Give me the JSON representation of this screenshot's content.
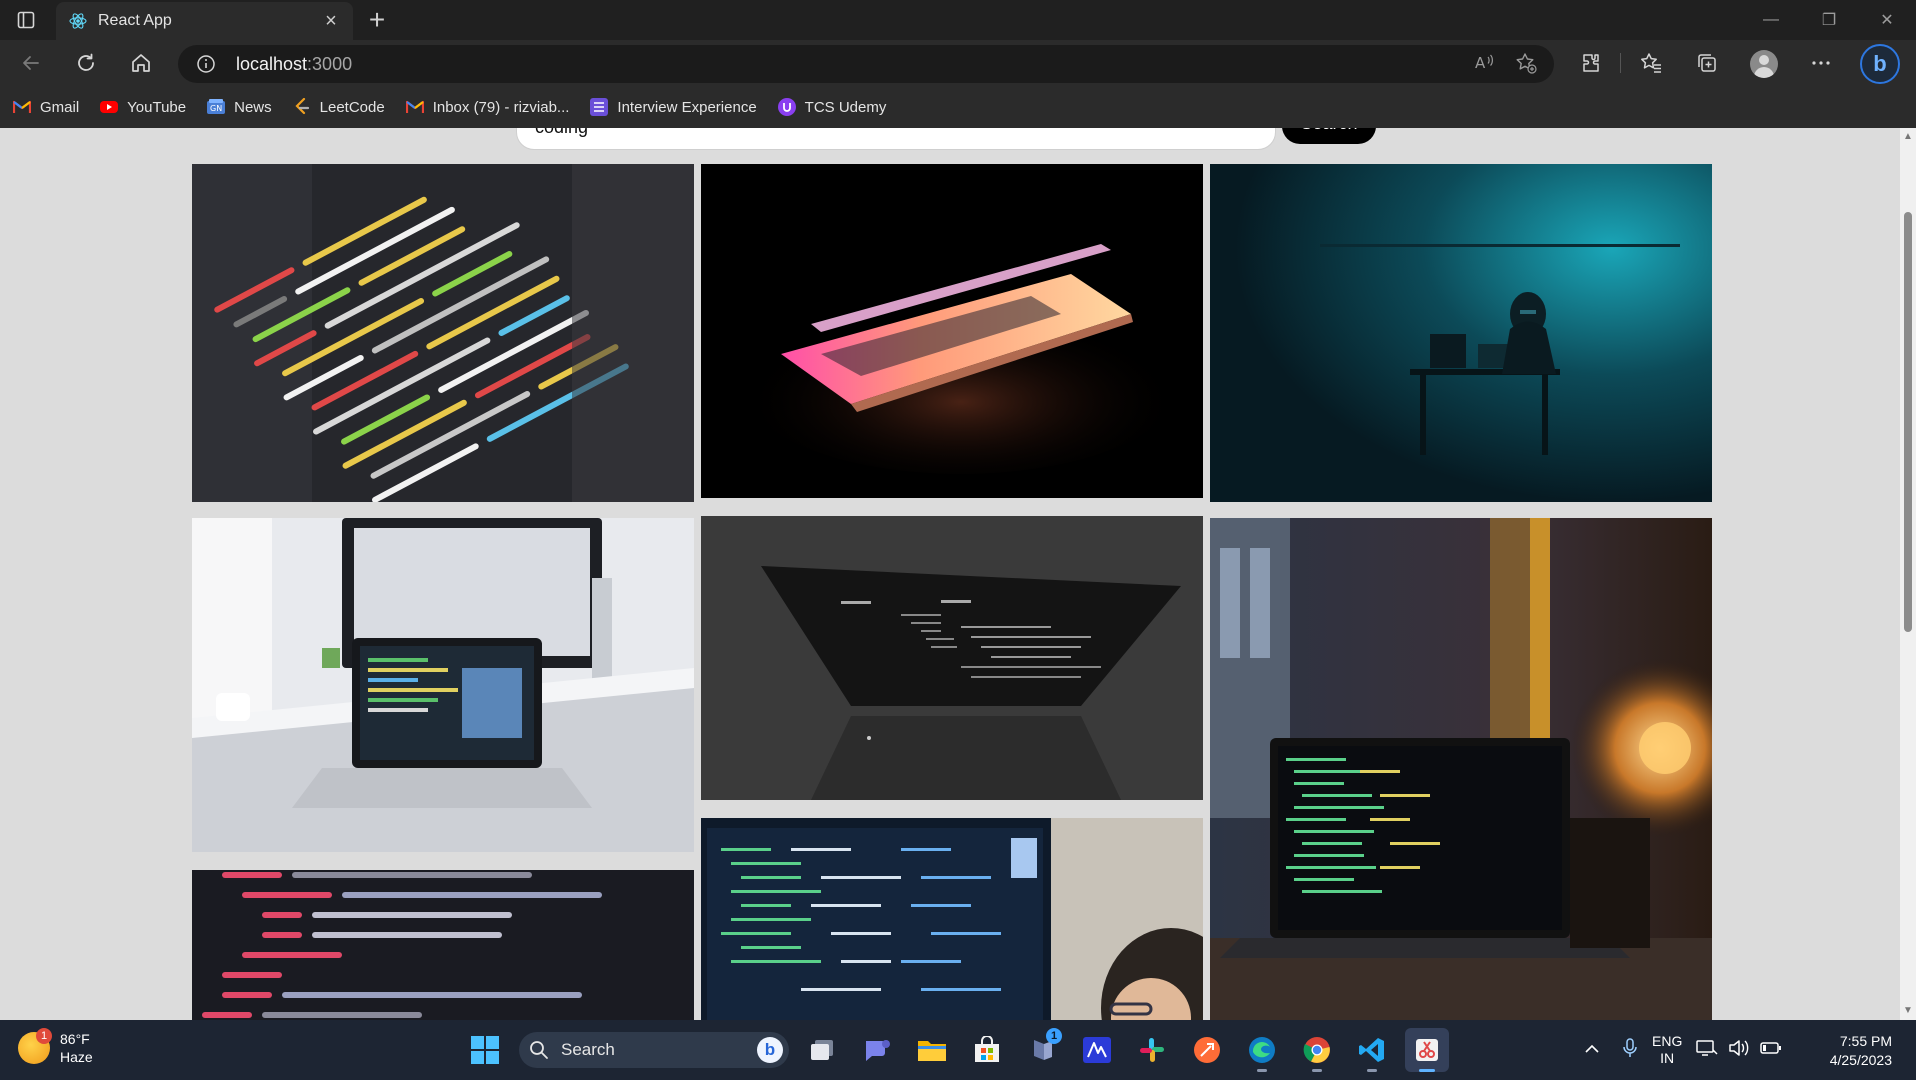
{
  "browser": {
    "tab_title": "React App",
    "tab_close": "×",
    "new_tab": "+",
    "window_controls": {
      "minimize": "—",
      "restore": "❐",
      "close": "✕"
    }
  },
  "toolbar": {
    "url_host": "localhost",
    "url_port": ":3000"
  },
  "favorites": [
    {
      "label": "Gmail",
      "icon": "gmail-icon"
    },
    {
      "label": "YouTube",
      "icon": "youtube-icon"
    },
    {
      "label": "News",
      "icon": "news-icon"
    },
    {
      "label": "LeetCode",
      "icon": "leetcode-icon"
    },
    {
      "label": "Inbox (79) - rizviab...",
      "icon": "gmail-icon"
    },
    {
      "label": "Interview Experience",
      "icon": "list-icon"
    },
    {
      "label": "TCS Udemy",
      "icon": "udemy-icon"
    }
  ],
  "page": {
    "search_value": "coding",
    "search_button": "Search",
    "images": [
      {
        "subject": "code-closeup-dark"
      },
      {
        "subject": "glowing-laptop"
      },
      {
        "subject": "hooded-person-desk"
      },
      {
        "subject": "laptop-white-desk"
      },
      {
        "subject": "dark-laptop-code"
      },
      {
        "subject": "laptop-code-lamp"
      },
      {
        "subject": "html-code-screen"
      },
      {
        "subject": "monitor-code-person"
      }
    ]
  },
  "taskbar": {
    "weather_badge": "1",
    "temperature": "86°F",
    "condition": "Haze",
    "search_label": "Search",
    "teams_badge": "1",
    "lang_line1": "ENG",
    "lang_line2": "IN",
    "time": "7:55 PM",
    "date": "4/25/2023"
  },
  "colors": {
    "browser_bg": "#202020",
    "toolbar_bg": "#2b2b2b",
    "page_bg": "#dcdcdc",
    "taskbar_bg": "#1d2533",
    "accent": "#5fb3ff"
  }
}
